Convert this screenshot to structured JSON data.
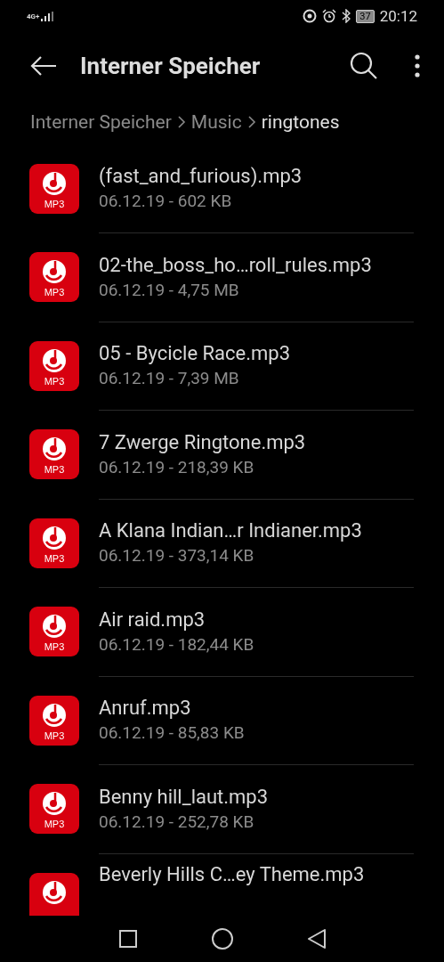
{
  "status_bar": {
    "network": "4G+",
    "battery": "37",
    "time": "20:12"
  },
  "toolbar": {
    "title": "Interner Speicher"
  },
  "breadcrumb": [
    {
      "label": "Interner Speicher",
      "selected": false
    },
    {
      "label": "Music",
      "selected": false
    },
    {
      "label": "ringtones",
      "selected": true
    }
  ],
  "files": [
    {
      "name": "(fast_and_furious).mp3",
      "meta": "06.12.19 - 602 KB",
      "badge": "MP3"
    },
    {
      "name": "02-the_boss_ho…roll_rules.mp3",
      "meta": "06.12.19 - 4,75 MB",
      "badge": "MP3"
    },
    {
      "name": "05 - Bycicle Race.mp3",
      "meta": "06.12.19 - 7,39 MB",
      "badge": "MP3"
    },
    {
      "name": "7 Zwerge Ringtone.mp3",
      "meta": "06.12.19 - 218,39 KB",
      "badge": "MP3"
    },
    {
      "name": "A Klana Indian…r Indianer.mp3",
      "meta": "06.12.19 - 373,14 KB",
      "badge": "MP3"
    },
    {
      "name": "Air raid.mp3",
      "meta": "06.12.19 - 182,44 KB",
      "badge": "MP3"
    },
    {
      "name": "Anruf.mp3",
      "meta": "06.12.19 - 85,83 KB",
      "badge": "MP3"
    },
    {
      "name": "Benny hill_laut.mp3",
      "meta": "06.12.19 - 252,78 KB",
      "badge": "MP3"
    },
    {
      "name": "Beverly Hills C…ey Theme.mp3"
    }
  ]
}
